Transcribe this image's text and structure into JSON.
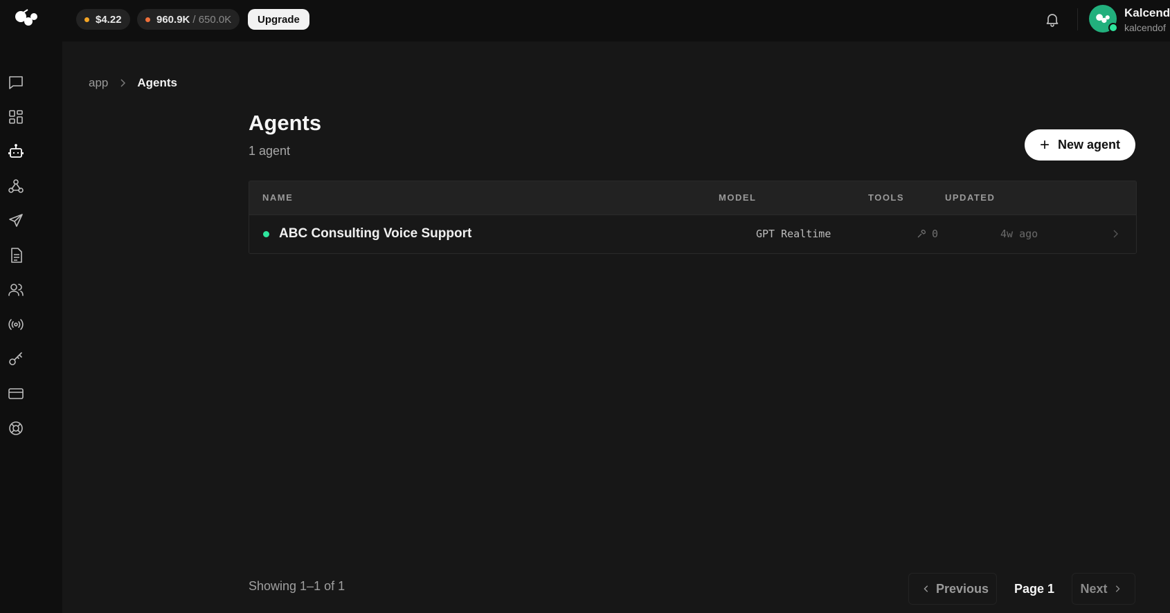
{
  "header": {
    "credit_balance": "$4.22",
    "usage_used": "960.9K",
    "usage_limit": "/ 650.0K",
    "upgrade_label": "Upgrade",
    "user_name": "Kalcend",
    "user_handle": "kalcendof"
  },
  "sidebar": {
    "items": [
      {
        "icon": "chat-icon"
      },
      {
        "icon": "dashboard-icon"
      },
      {
        "icon": "robot-icon"
      },
      {
        "icon": "webhook-icon"
      },
      {
        "icon": "send-icon"
      },
      {
        "icon": "document-icon"
      },
      {
        "icon": "users-icon"
      },
      {
        "icon": "broadcast-icon"
      },
      {
        "icon": "key-icon"
      },
      {
        "icon": "credit-card-icon"
      },
      {
        "icon": "lifebuoy-icon"
      }
    ]
  },
  "breadcrumb": {
    "root": "app",
    "current": "Agents"
  },
  "page": {
    "title": "Agents",
    "subtitle": "1 agent",
    "new_button": "New agent"
  },
  "table": {
    "columns": [
      "NAME",
      "MODEL",
      "TOOLS",
      "UPDATED"
    ],
    "rows": [
      {
        "name": "ABC Consulting Voice Support",
        "model": "GPT Realtime",
        "tools": "0",
        "updated": "4w ago",
        "status_color": "#2ee59d"
      }
    ]
  },
  "pagination": {
    "showing": "Showing 1–1 of 1",
    "previous": "Previous",
    "page": "Page 1",
    "next": "Next"
  },
  "colors": {
    "accent": "#22b07d",
    "status_active": "#2ee59d",
    "background": "#0f0f0f",
    "panel": "#171717"
  }
}
